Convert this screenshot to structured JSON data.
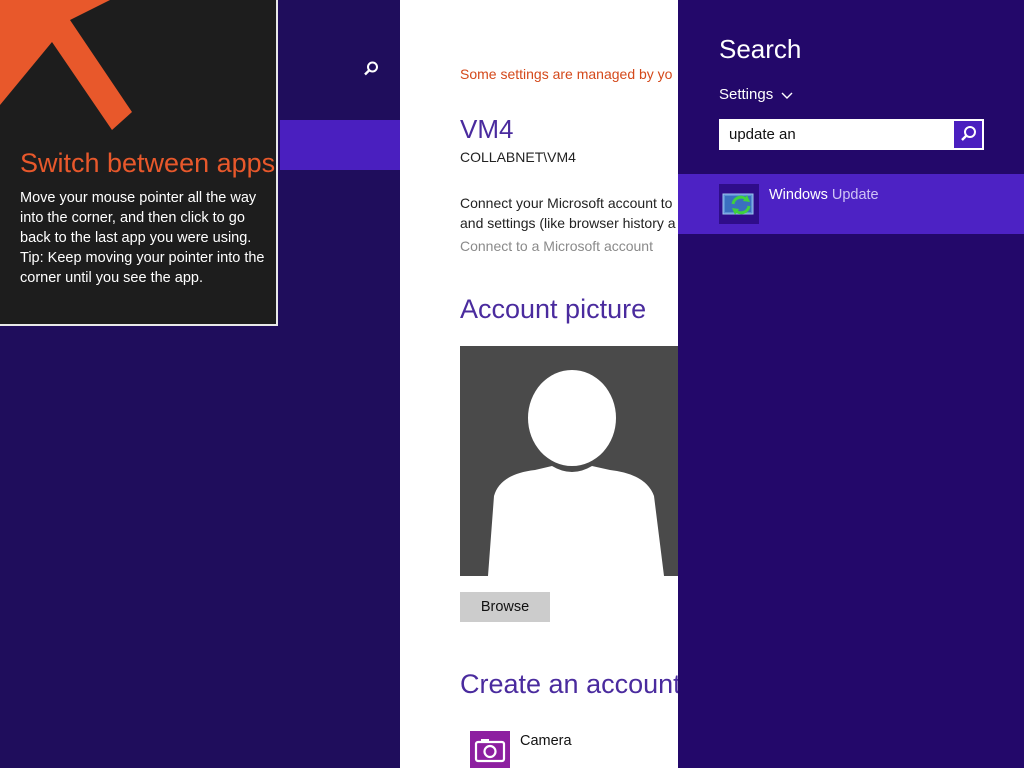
{
  "tip": {
    "title": "Switch between apps",
    "body": "Move your mouse pointer all the way into the corner, and then click to go back to the last app you were using.",
    "tip_text": "Tip: Keep moving your pointer into the corner until you see the app.",
    "arrow_color": "#e8582b"
  },
  "settings": {
    "managed_notice": "Some settings are managed by yo",
    "account_name": "VM4",
    "account_domain": "COLLABNET\\VM4",
    "connect_text_1": "Connect your Microsoft account to",
    "connect_text_2": "and settings (like browser history a",
    "connect_link": "Connect to a Microsoft account",
    "account_picture_heading": "Account picture",
    "browse_label": "Browse",
    "create_heading": "Create an account p",
    "camera_label": "Camera"
  },
  "search": {
    "title": "Search",
    "scope": "Settings",
    "query": "update an",
    "results": [
      {
        "label_bold": "Windows",
        "label_rest": " Update",
        "icon": "windows-update-icon"
      }
    ]
  },
  "colors": {
    "accent": "#4a1fbf",
    "background": "#1d0a56",
    "heading": "#4a2b9e"
  }
}
